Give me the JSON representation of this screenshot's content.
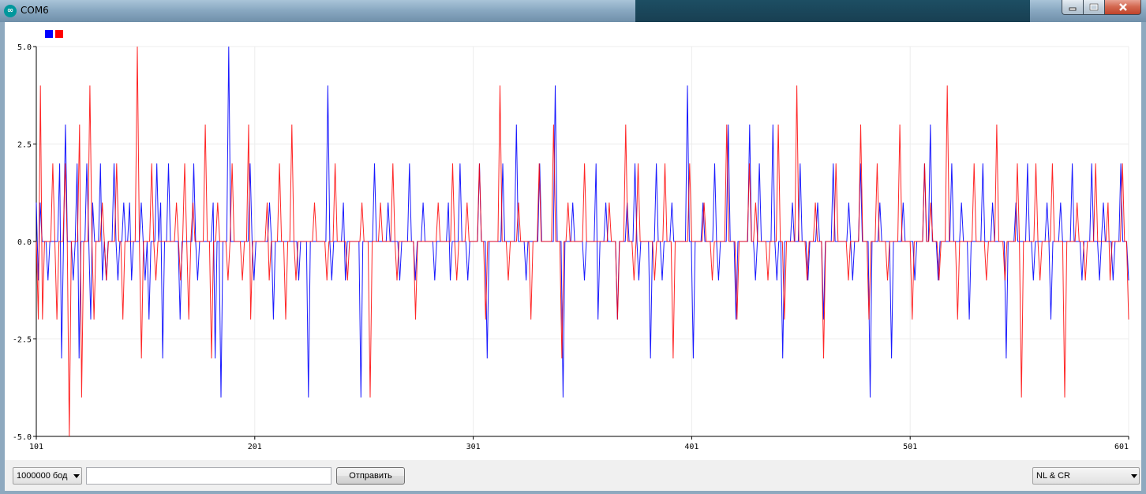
{
  "window": {
    "title": "COM6"
  },
  "toolbar": {
    "baud_rate": "1000000 бод",
    "message_value": "",
    "send_label": "Отправить",
    "line_ending": "NL & CR"
  },
  "chart_data": {
    "type": "line",
    "x_start": 101,
    "x_end": 601,
    "ylim": [
      -5.0,
      5.0
    ],
    "yticks": [
      "5.0",
      "2.5",
      "0.0",
      "-2.5",
      "-5.0"
    ],
    "yticks_values": [
      5,
      2.5,
      0,
      -2.5,
      -5
    ],
    "xticks": [
      "101",
      "201",
      "301",
      "401",
      "501",
      "601"
    ],
    "xticks_values": [
      101,
      201,
      301,
      401,
      501,
      601
    ],
    "grid": true,
    "legend": "top-left",
    "series": [
      {
        "color": "#0000ff",
        "values": [
          1,
          -1,
          1,
          0,
          0,
          0,
          -1,
          0,
          0,
          0,
          0,
          0,
          2,
          -3,
          0,
          3,
          0,
          0,
          0,
          -1,
          0,
          2,
          -3,
          0,
          0,
          0,
          2,
          0,
          -2,
          1,
          0,
          0,
          0,
          2,
          -1,
          0,
          -1,
          0,
          0,
          0,
          2,
          0,
          -1,
          0,
          0,
          1,
          0,
          0,
          1,
          -1,
          0,
          0,
          0,
          0,
          1,
          0,
          -1,
          0,
          -2,
          0,
          0,
          0,
          2,
          0,
          1,
          -3,
          0,
          0,
          2,
          0,
          0,
          0,
          0,
          0,
          -2,
          0,
          0,
          0,
          0,
          0,
          0,
          2,
          0,
          -1,
          0,
          0,
          0,
          0,
          0,
          0,
          0,
          1,
          -3,
          0,
          0,
          -4,
          0,
          0,
          0,
          5,
          0,
          0,
          0,
          0,
          0,
          0,
          0,
          0,
          0,
          0,
          2,
          0,
          -1,
          0,
          0,
          0,
          0,
          0,
          0,
          0,
          1,
          0,
          -2,
          0,
          0,
          0,
          0,
          0,
          0,
          0,
          0,
          0,
          0,
          0,
          0,
          -1,
          0,
          0,
          0,
          0,
          -4,
          0,
          0,
          0,
          0,
          0,
          0,
          0,
          0,
          0,
          4,
          0,
          -1,
          0,
          0,
          0,
          0,
          0,
          1,
          -1,
          0,
          0,
          0,
          0,
          0,
          0,
          0,
          -4,
          0,
          0,
          0,
          0,
          0,
          0,
          2,
          0,
          0,
          0,
          0,
          0,
          0,
          1,
          0,
          0,
          0,
          0,
          0,
          -1,
          0,
          0,
          0,
          0,
          2,
          0,
          0,
          -1,
          0,
          0,
          0,
          1,
          0,
          0,
          0,
          0,
          0,
          -1,
          0,
          0,
          0,
          0,
          0,
          0,
          1,
          -1,
          0,
          0,
          0,
          0,
          2,
          0,
          0,
          0,
          -1,
          0,
          0,
          0,
          0,
          0,
          2,
          0,
          0,
          0,
          -3,
          0,
          0,
          0,
          0,
          0,
          0,
          0,
          2,
          0,
          0,
          0,
          0,
          0,
          0,
          3,
          0,
          0,
          0,
          0,
          -1,
          0,
          0,
          0,
          0,
          0,
          0,
          2,
          0,
          0,
          0,
          0,
          0,
          0,
          0,
          4,
          0,
          0,
          0,
          -4,
          0,
          0,
          0,
          0,
          1,
          0,
          0,
          0,
          0,
          0,
          -1,
          0,
          0,
          0,
          0,
          0,
          2,
          -2,
          0,
          0,
          0,
          1,
          0,
          0,
          0,
          0,
          0,
          -2,
          0,
          0,
          0,
          0,
          1,
          0,
          0,
          0,
          2,
          0,
          -1,
          0,
          0,
          0,
          0,
          0,
          -3,
          0,
          0,
          2,
          0,
          0,
          -1,
          0,
          0,
          0,
          0,
          1,
          0,
          0,
          0,
          0,
          0,
          0,
          0,
          4,
          0,
          0,
          -3,
          0,
          0,
          0,
          0,
          1,
          0,
          0,
          0,
          0,
          0,
          2,
          0,
          -1,
          0,
          0,
          0,
          0,
          3,
          0,
          0,
          0,
          -2,
          0,
          0,
          0,
          0,
          0,
          0,
          3,
          0,
          0,
          -1,
          0,
          2,
          0,
          0,
          0,
          0,
          0,
          0,
          3,
          0,
          -1,
          0,
          0,
          -3,
          0,
          0,
          0,
          0,
          1,
          0,
          0,
          0,
          2,
          0,
          0,
          0,
          -1,
          0,
          0,
          0,
          0,
          1,
          0,
          0,
          -2,
          0,
          0,
          0,
          0,
          2,
          0,
          0,
          0,
          0,
          0,
          0,
          0,
          1,
          0,
          -1,
          0,
          0,
          0,
          2,
          0,
          0,
          0,
          0,
          -4,
          0,
          0,
          0,
          0,
          1,
          0,
          0,
          0,
          0,
          0,
          -3,
          0,
          0,
          0,
          0,
          0,
          1,
          0,
          0,
          0,
          0,
          0,
          -1,
          0,
          0,
          0,
          0,
          2,
          0,
          0,
          3,
          0,
          0,
          0,
          -1,
          0,
          0,
          0,
          0,
          0,
          0,
          2,
          0,
          0,
          0,
          0,
          1,
          0,
          0,
          0,
          -2,
          0,
          0,
          0,
          0,
          0,
          0,
          2,
          0,
          0,
          0,
          0,
          1,
          0,
          0,
          0,
          0,
          0,
          0,
          -3,
          0,
          0,
          0,
          0,
          1,
          0,
          0,
          0,
          0,
          0,
          2,
          0,
          0,
          -1,
          0,
          0,
          0,
          0,
          0,
          0,
          1,
          0,
          -2,
          0,
          0,
          0,
          0,
          1,
          0,
          0,
          0,
          0,
          0,
          2,
          0,
          0,
          0,
          0,
          -1,
          0,
          0,
          0,
          0,
          2,
          0,
          0,
          0,
          -1,
          0,
          1,
          0,
          0,
          0,
          0,
          -1,
          0,
          0,
          0,
          2,
          0,
          0,
          0,
          -1
        ]
      },
      {
        "color": "#ff0000",
        "values": [
          0,
          -2,
          4,
          -2,
          0,
          0,
          0,
          0,
          2,
          0,
          -2,
          0,
          0,
          0,
          2,
          0,
          -5,
          0,
          0,
          0,
          0,
          3,
          -4,
          0,
          0,
          0,
          4,
          0,
          -2,
          0,
          0,
          0,
          1,
          0,
          -1,
          0,
          0,
          0,
          0,
          2,
          0,
          0,
          -2,
          0,
          0,
          0,
          0,
          0,
          0,
          5,
          0,
          -3,
          0,
          0,
          0,
          0,
          2,
          0,
          -1,
          0,
          0,
          0,
          0,
          0,
          0,
          0,
          0,
          0,
          1,
          0,
          -1,
          0,
          2,
          0,
          -2,
          0,
          1,
          0,
          0,
          0,
          0,
          0,
          3,
          0,
          0,
          -3,
          0,
          0,
          1,
          0,
          0,
          0,
          0,
          -1,
          0,
          2,
          0,
          0,
          0,
          0,
          -1,
          0,
          0,
          3,
          -2,
          0,
          0,
          0,
          0,
          0,
          0,
          0,
          1,
          -1,
          0,
          0,
          0,
          0,
          2,
          0,
          0,
          -2,
          0,
          0,
          3,
          0,
          -1,
          0,
          0,
          0,
          0,
          0,
          0,
          0,
          0,
          1,
          0,
          0,
          0,
          0,
          0,
          -1,
          0,
          0,
          0,
          2,
          0,
          0,
          0,
          0,
          0,
          -1,
          0,
          0,
          0,
          0,
          0,
          0,
          1,
          0,
          0,
          0,
          -4,
          0,
          0,
          0,
          0,
          1,
          0,
          0,
          0,
          0,
          0,
          2,
          0,
          -1,
          0,
          0,
          0,
          0,
          0,
          0,
          0,
          0,
          -2,
          0,
          0,
          0,
          0,
          0,
          0,
          0,
          0,
          0,
          0,
          1,
          0,
          0,
          0,
          0,
          0,
          0,
          2,
          0,
          -1,
          0,
          0,
          0,
          0,
          1,
          0,
          0,
          0,
          0,
          0,
          2,
          0,
          0,
          -2,
          0,
          0,
          0,
          0,
          0,
          0,
          4,
          0,
          0,
          0,
          -1,
          0,
          0,
          0,
          0,
          1,
          0,
          0,
          0,
          0,
          0,
          -2,
          0,
          0,
          0,
          2,
          0,
          0,
          0,
          0,
          0,
          0,
          3,
          0,
          0,
          0,
          -3,
          0,
          0,
          1,
          0,
          0,
          0,
          0,
          0,
          0,
          0,
          2,
          0,
          0,
          0,
          0,
          0,
          0,
          0,
          0,
          0,
          0,
          0,
          1,
          0,
          0,
          0,
          -2,
          0,
          0,
          0,
          3,
          0,
          0,
          0,
          -1,
          0,
          2,
          0,
          0,
          0,
          0,
          0,
          0,
          0,
          -1,
          0,
          0,
          0,
          0,
          2,
          0,
          0,
          0,
          -3,
          0,
          0,
          0,
          0,
          0,
          0,
          0,
          2,
          0,
          0,
          0,
          0,
          0,
          0,
          1,
          0,
          0,
          0,
          -1,
          0,
          0,
          0,
          0,
          0,
          0,
          3,
          0,
          0,
          0,
          0,
          -2,
          0,
          0,
          0,
          0,
          0,
          2,
          0,
          0,
          1,
          0,
          0,
          0,
          0,
          0,
          -1,
          0,
          0,
          0,
          0,
          3,
          0,
          0,
          -2,
          0,
          0,
          0,
          0,
          0,
          4,
          0,
          0,
          0,
          0,
          -1,
          0,
          0,
          0,
          1,
          0,
          0,
          0,
          -3,
          0,
          0,
          0,
          0,
          0,
          2,
          0,
          0,
          0,
          0,
          0,
          -1,
          0,
          0,
          0,
          0,
          0,
          3,
          0,
          0,
          0,
          -2,
          0,
          0,
          0,
          2,
          0,
          0,
          0,
          0,
          -1,
          0,
          0,
          0,
          0,
          0,
          3,
          0,
          0,
          0,
          0,
          0,
          -2,
          0,
          0,
          0,
          0,
          0,
          2,
          0,
          0,
          1,
          0,
          0,
          0,
          -1,
          0,
          0,
          0,
          4,
          0,
          0,
          0,
          0,
          -2,
          0,
          0,
          0,
          0,
          0,
          0,
          0,
          2,
          0,
          0,
          0,
          0,
          0,
          -1,
          0,
          0,
          0,
          0,
          3,
          0,
          0,
          0,
          -1,
          0,
          0,
          0,
          0,
          0,
          2,
          0,
          -4,
          0,
          0,
          0,
          0,
          0,
          0,
          2,
          0,
          -1,
          0,
          0,
          0,
          0,
          0,
          2,
          0,
          0,
          0,
          0,
          0,
          -4,
          0,
          0,
          0,
          0,
          0,
          1,
          0,
          0,
          0,
          -1,
          0,
          0,
          0,
          0,
          2,
          0,
          0,
          0,
          0,
          0,
          1,
          -1,
          0,
          0,
          0,
          0,
          0,
          2,
          0,
          0,
          -2
        ]
      }
    ]
  }
}
